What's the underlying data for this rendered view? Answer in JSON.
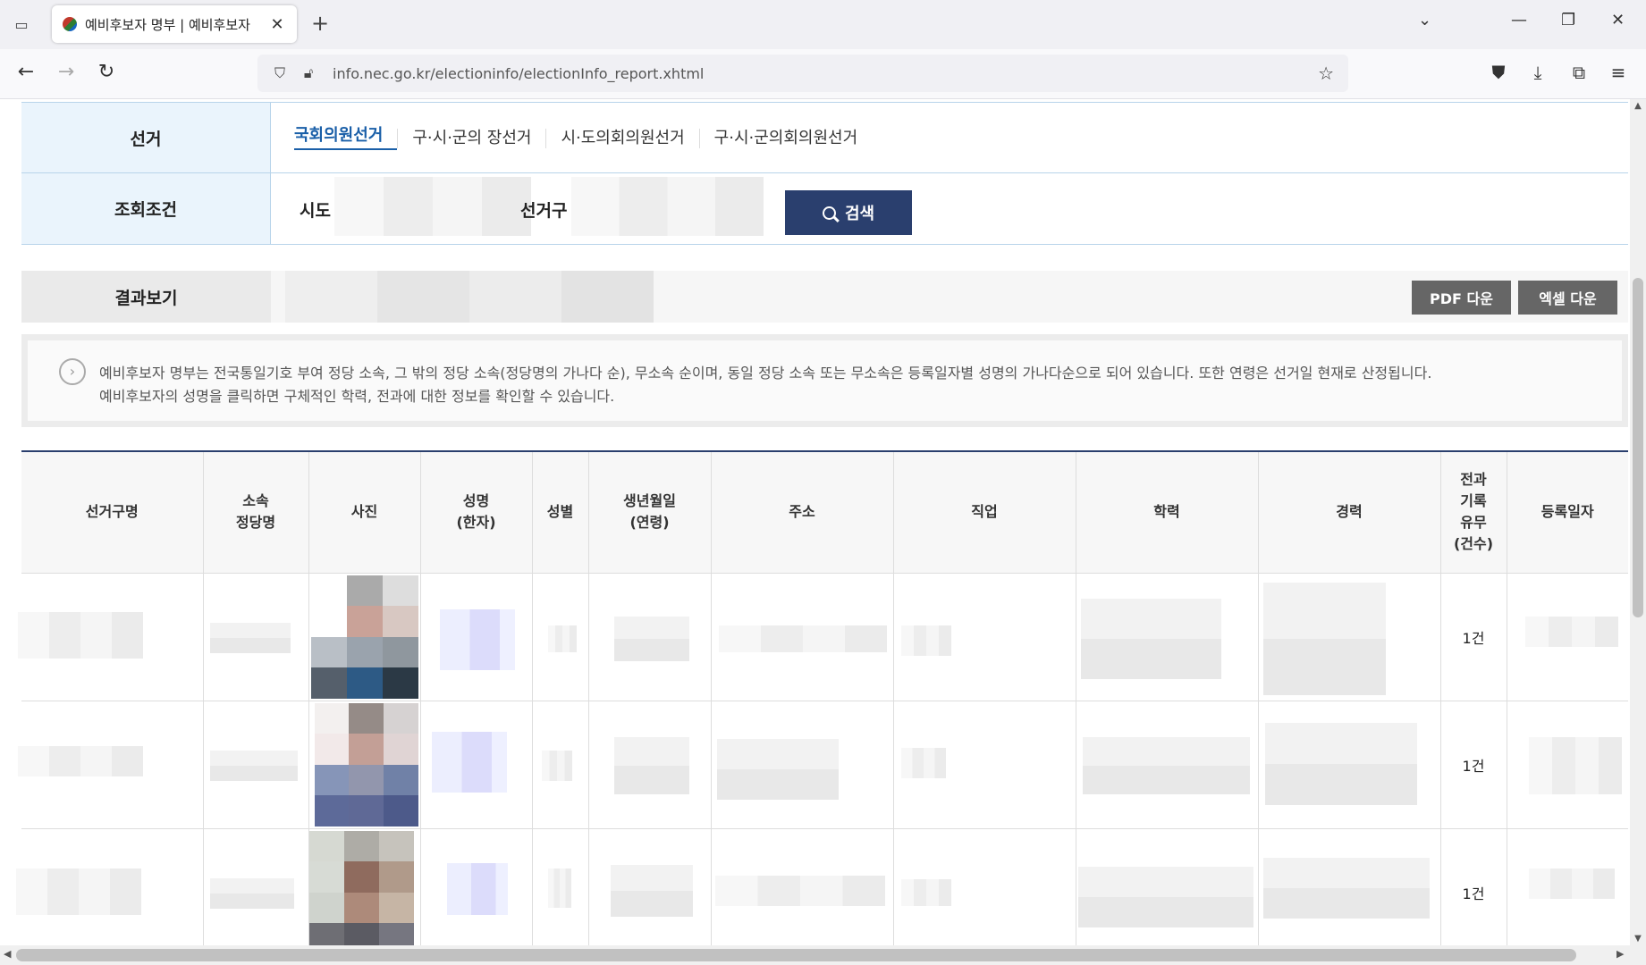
{
  "browser": {
    "tab_title": "예비후보자 명부 | 예비후보자",
    "url": "info.nec.go.kr/electioninfo/electionInfo_report.xhtml"
  },
  "search": {
    "election_label": "선거",
    "election_tabs": [
      "국회의원선거",
      "구·시·군의 장선거",
      "시·도의회의원선거",
      "구·시·군의회의원선거"
    ],
    "active_tab": 0,
    "condition_label": "조회조건",
    "sido_label": "시도",
    "district_label": "선거구",
    "search_button": "검색"
  },
  "result": {
    "label": "결과보기",
    "pdf_button": "PDF 다운",
    "excel_button": "엑셀 다운"
  },
  "notice": {
    "line1": "예비후보자 명부는 전국통일기호 부여 정당 소속, 그 밖의 정당 소속(정당명의 가나다 순), 무소속 순이며, 동일 정당 소속 또는 무소속은 등록일자별 성명의 가나다순으로 되어 있습니다. 또한 연령은 선거일 현재로 산정됩니다.",
    "line2": "예비후보자의 성명을 클릭하면 구체적인 학력, 전과에 대한 정보를 확인할 수 있습니다."
  },
  "table": {
    "headers": {
      "district": "선거구명",
      "party": [
        "소속",
        "정당명"
      ],
      "photo": "사진",
      "name": [
        "성명",
        "(한자)"
      ],
      "gender": "성별",
      "birth": [
        "생년월일",
        "(연령)"
      ],
      "address": "주소",
      "job": "직업",
      "education": "학력",
      "career": "경력",
      "criminal": [
        "전과",
        "기록",
        "유무",
        "(건수)"
      ],
      "reg_date": "등록일자"
    },
    "rows": [
      {
        "criminal": "1건"
      },
      {
        "criminal": "1건"
      },
      {
        "criminal": "1건"
      }
    ]
  },
  "colors": {
    "accent": "#2a3f6e",
    "tab_active": "#1a5fa8",
    "label_bg": "#eaf4fc"
  }
}
